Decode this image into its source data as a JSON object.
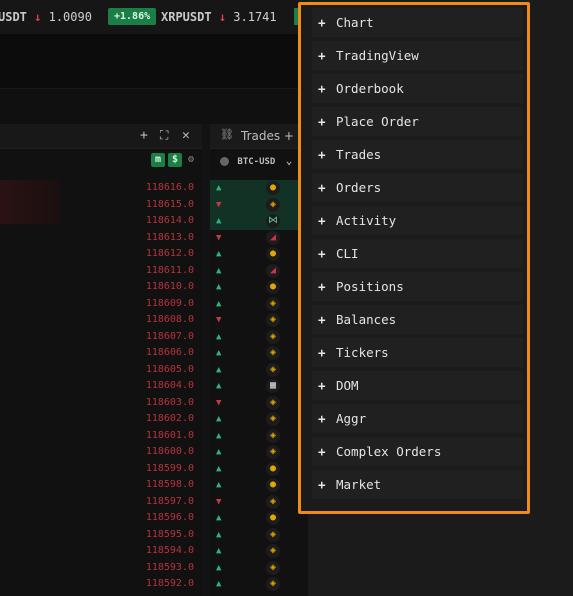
{
  "ticker_bar": {
    "items": [
      {
        "symbol": "USDT",
        "direction": "down",
        "price": "1.0090"
      },
      {
        "change": "+1.86%"
      },
      {
        "symbol": "XRPUSDT",
        "direction": "down",
        "price": "3.1741"
      }
    ],
    "down_arrow": "↓"
  },
  "left_panel": {
    "header_icons": {
      "add": "+",
      "expand": "⛶",
      "close": "✕"
    },
    "buttons": {
      "m": "m",
      "dollar": "$",
      "gear": "⚙"
    },
    "prices": [
      "118616.0",
      "118615.0",
      "118614.0",
      "118613.0",
      "118612.0",
      "118611.0",
      "118610.0",
      "118609.0",
      "118608.0",
      "118607.0",
      "118606.0",
      "118605.0",
      "118604.0",
      "118603.0",
      "118602.0",
      "118601.0",
      "118600.0",
      "118599.0",
      "118598.0",
      "118597.0",
      "118596.0",
      "118595.0",
      "118594.0",
      "118593.0",
      "118592.0"
    ]
  },
  "trades_panel": {
    "link_icon": "⛓",
    "title": "Trades + Lic",
    "symbol": "BTC-USD",
    "chevron": "⌄",
    "rows": [
      {
        "dir": "up",
        "exch": "coinbase",
        "hl": true
      },
      {
        "dir": "dn",
        "exch": "binance",
        "hl": true
      },
      {
        "dir": "up",
        "exch": "bitfinex",
        "hl": true
      },
      {
        "dir": "dn",
        "exch": "bitmex",
        "hl": false
      },
      {
        "dir": "up",
        "exch": "coinbase",
        "hl": false
      },
      {
        "dir": "up",
        "exch": "bitmex",
        "hl": false
      },
      {
        "dir": "up",
        "exch": "coinbase",
        "hl": false
      },
      {
        "dir": "up",
        "exch": "binance",
        "hl": false
      },
      {
        "dir": "dn",
        "exch": "binance",
        "hl": false
      },
      {
        "dir": "up",
        "exch": "binance",
        "hl": false
      },
      {
        "dir": "up",
        "exch": "binance",
        "hl": false
      },
      {
        "dir": "up",
        "exch": "binance",
        "hl": false
      },
      {
        "dir": "up",
        "exch": "okx",
        "hl": false
      },
      {
        "dir": "dn",
        "exch": "binance",
        "hl": false
      },
      {
        "dir": "up",
        "exch": "binance",
        "hl": false
      },
      {
        "dir": "up",
        "exch": "binance",
        "hl": false
      },
      {
        "dir": "up",
        "exch": "binance",
        "hl": false
      },
      {
        "dir": "up",
        "exch": "coinbase",
        "hl": false
      },
      {
        "dir": "up",
        "exch": "coinbase",
        "hl": false
      },
      {
        "dir": "dn",
        "exch": "binance",
        "hl": false
      },
      {
        "dir": "up",
        "exch": "coinbase",
        "hl": false
      },
      {
        "dir": "up",
        "exch": "binance",
        "hl": false
      },
      {
        "dir": "up",
        "exch": "binance",
        "hl": false
      },
      {
        "dir": "up",
        "exch": "binance",
        "hl": false
      },
      {
        "dir": "up",
        "exch": "binance",
        "hl": false
      }
    ]
  },
  "add_panel_menu": {
    "plus": "+",
    "items": [
      "Chart",
      "TradingView",
      "Orderbook",
      "Place Order",
      "Trades",
      "Orders",
      "Activity",
      "CLI",
      "Positions",
      "Balances",
      "Tickers",
      "DOM",
      "Aggr",
      "Complex Orders",
      "Market"
    ]
  },
  "colors": {
    "accent_border": "#f08a1a",
    "up": "#2fb37c",
    "down": "#c23a46",
    "badge": "#1a7f45"
  }
}
